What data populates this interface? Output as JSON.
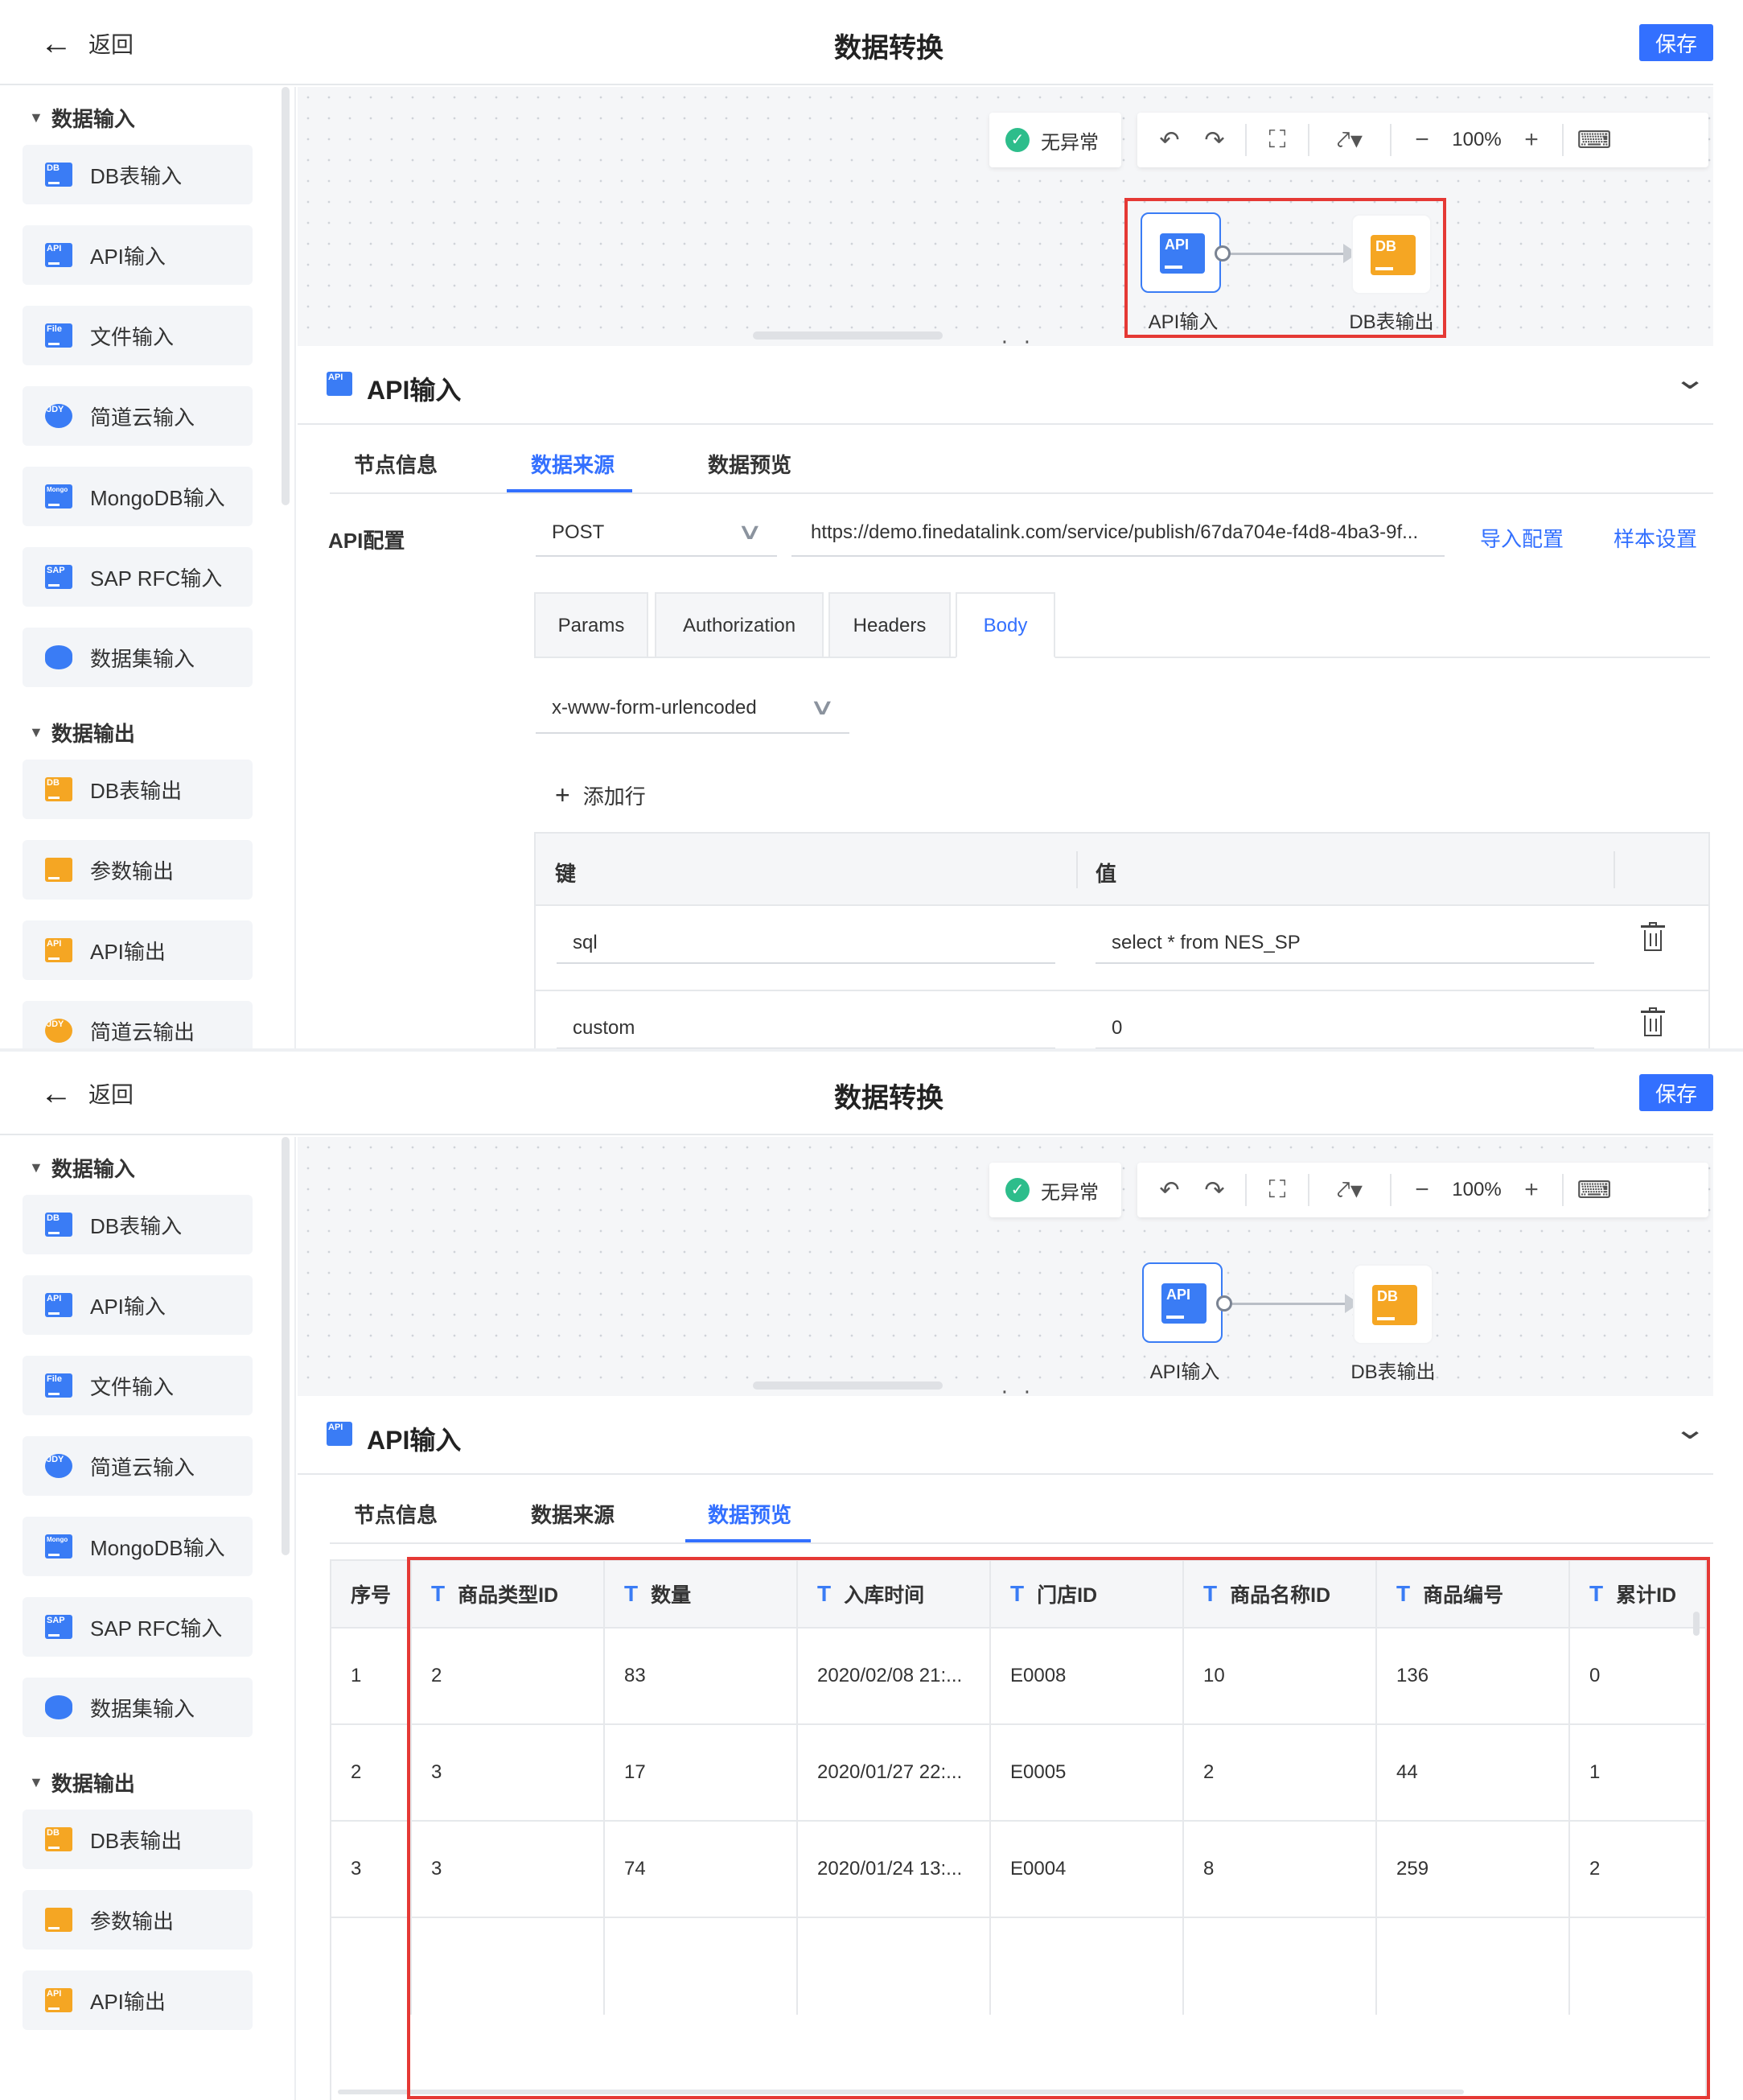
{
  "header": {
    "back_label": "返回",
    "title": "数据转换",
    "save_label": "保存"
  },
  "sidebar": {
    "input_section": "数据输入",
    "output_section": "数据输出",
    "input_items": [
      {
        "label": "DB表输入",
        "icon": "db-input-icon",
        "badge": "DB"
      },
      {
        "label": "API输入",
        "icon": "api-input-icon",
        "badge": "API"
      },
      {
        "label": "文件输入",
        "icon": "file-input-icon",
        "badge": "File"
      },
      {
        "label": "简道云输入",
        "icon": "jdy-input-icon",
        "badge": "JDY"
      },
      {
        "label": "MongoDB输入",
        "icon": "mongodb-input-icon",
        "badge": "Mongo"
      },
      {
        "label": "SAP RFC输入",
        "icon": "sap-input-icon",
        "badge": "SAP"
      },
      {
        "label": "数据集输入",
        "icon": "dataset-input-icon",
        "badge": ""
      }
    ],
    "output_items": [
      {
        "label": "DB表输出",
        "icon": "db-output-icon",
        "badge": "DB"
      },
      {
        "label": "参数输出",
        "icon": "param-output-icon",
        "badge": ""
      },
      {
        "label": "API输出",
        "icon": "api-output-icon",
        "badge": "API"
      },
      {
        "label": "简道云输出",
        "icon": "jdy-output-icon",
        "badge": "JDY"
      }
    ]
  },
  "canvas": {
    "status": "无异常",
    "zoom": "100%",
    "nodes": [
      {
        "label": "API输入",
        "badge": "API"
      },
      {
        "label": "DB表输出",
        "badge": "DB"
      }
    ]
  },
  "node_panel": {
    "title": "API输入",
    "tabs": [
      "节点信息",
      "数据来源",
      "数据预览"
    ]
  },
  "config": {
    "api_label": "API配置",
    "method": "POST",
    "url": "https://demo.finedatalink.com/service/publish/67da704e-f4d8-4ba3-9f...",
    "import_link": "导入配置",
    "sample_link": "样本设置",
    "subtabs": [
      "Params",
      "Authorization",
      "Headers",
      "Body"
    ],
    "body_type": "x-www-form-urlencoded",
    "add_row": "添加行",
    "kv_headers": [
      "键",
      "值"
    ],
    "kv_rows": [
      {
        "key": "sql",
        "value": "select * from NES_SP"
      },
      {
        "key": "custom",
        "value": "0"
      }
    ]
  },
  "preview": {
    "columns": [
      "序号",
      "商品类型ID",
      "数量",
      "入库时间",
      "门店ID",
      "商品名称ID",
      "商品编号",
      "累计ID"
    ],
    "rows": [
      [
        "1",
        "2",
        "83",
        "2020/02/08 21:...",
        "E0008",
        "10",
        "136",
        "0"
      ],
      [
        "2",
        "3",
        "17",
        "2020/01/27 22:...",
        "E0005",
        "2",
        "44",
        "1"
      ],
      [
        "3",
        "3",
        "74",
        "2020/01/24 13:...",
        "E0004",
        "8",
        "259",
        "2"
      ]
    ]
  },
  "colors": {
    "accent": "#3370ff",
    "highlight": "#e53935",
    "api_icon": "#3a7cf5",
    "db_icon": "#f5a623",
    "ok": "#2dbd8b"
  }
}
